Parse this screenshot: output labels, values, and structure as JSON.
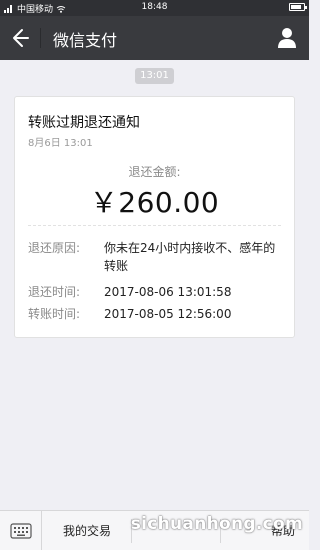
{
  "status_bar": {
    "carrier": "中国移动",
    "time": "18:48"
  },
  "header": {
    "title": "微信支付",
    "back_icon": "arrow-left-icon",
    "profile_icon": "person-icon"
  },
  "chat": {
    "timestamp": "13:01"
  },
  "card": {
    "title": "转账过期退还通知",
    "date": "8月6日  13:01",
    "amount_label": "退还金额:",
    "amount": "￥260.00",
    "details": [
      {
        "key": "退还原因:",
        "value": "你未在24小时内接收不、感年的转账"
      },
      {
        "key": "退还时间:",
        "value": "2017-08-06 13:01:58"
      },
      {
        "key": "转账时间:",
        "value": "2017-08-05 12:56:00"
      }
    ]
  },
  "bottom_menu": {
    "keyboard_icon": "keyboard-icon",
    "items": [
      "我的交易",
      "帮助"
    ]
  },
  "watermark": "sichuanhong.com",
  "colors": {
    "status_bar": "#2f3034",
    "header": "#393a3e",
    "background": "#efeff4",
    "card": "#ffffff"
  }
}
